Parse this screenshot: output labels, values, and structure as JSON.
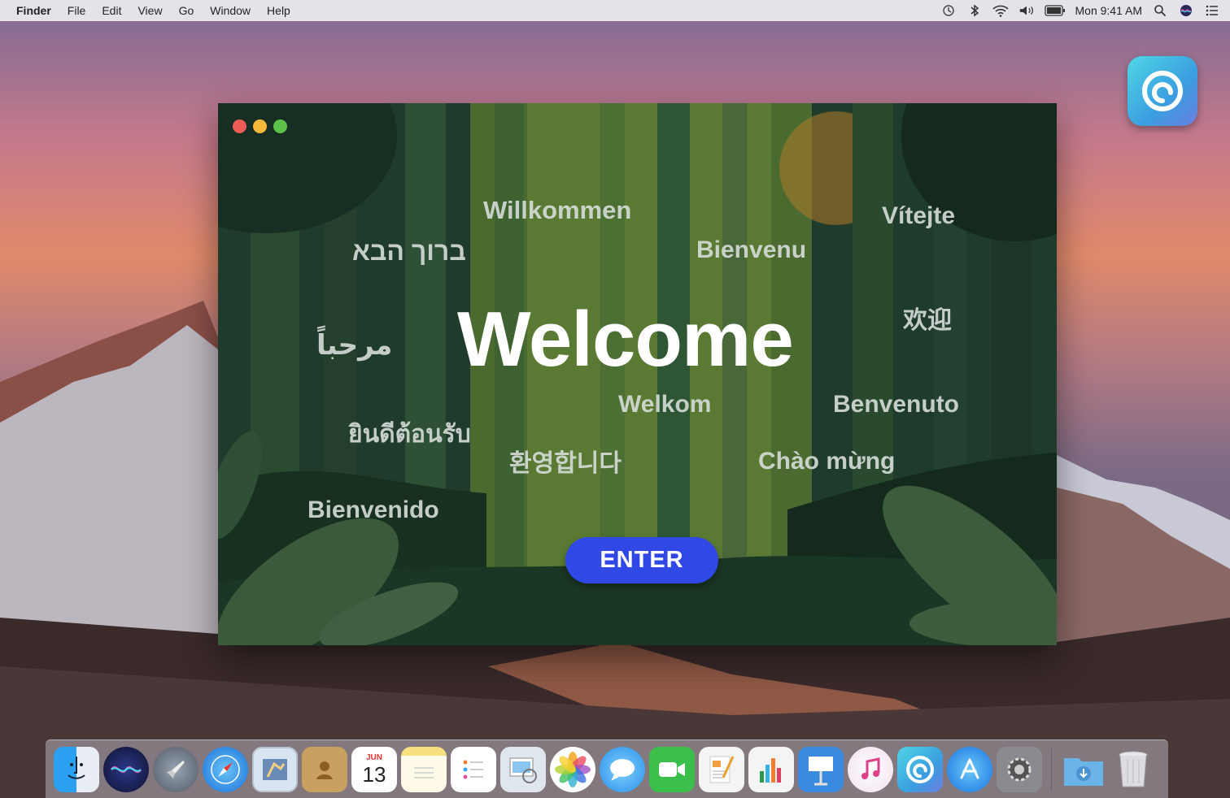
{
  "menubar": {
    "app": "Finder",
    "items": [
      "File",
      "Edit",
      "View",
      "Go",
      "Window",
      "Help"
    ],
    "clock": "Mon 9:41 AM"
  },
  "window": {
    "headline": "Welcome",
    "greetings": {
      "german": "Willkommen",
      "hebrew": "ברוך הבא",
      "french": "Bienvenu",
      "czech": "Vítejte",
      "chinese": "欢迎",
      "arabic": "مرحباً",
      "dutch": "Welkom",
      "italian": "Benvenuto",
      "thai": "ยินดีต้อนรับ",
      "korean": "환영합니다",
      "vietnamese": "Chào mừng",
      "spanish": "Bienvenido"
    },
    "enter_label": "ENTER"
  },
  "dock": {
    "calendar_month": "JUN",
    "calendar_day": "13",
    "items": [
      "finder-icon",
      "siri-icon",
      "launchpad-icon",
      "safari-icon",
      "mail-icon",
      "contacts-icon",
      "calendar-icon",
      "notes-icon",
      "reminders-icon",
      "preview-icon",
      "photos-icon",
      "messages-icon",
      "facetime-icon",
      "pages-icon",
      "numbers-icon",
      "keynote-icon",
      "itunes-icon",
      "app-icon",
      "app-store-icon",
      "system-preferences-icon",
      "downloads-folder-icon",
      "trash-icon"
    ]
  },
  "colors": {
    "accent": "#2f48e6",
    "window_bg": "#1e3a2a"
  }
}
